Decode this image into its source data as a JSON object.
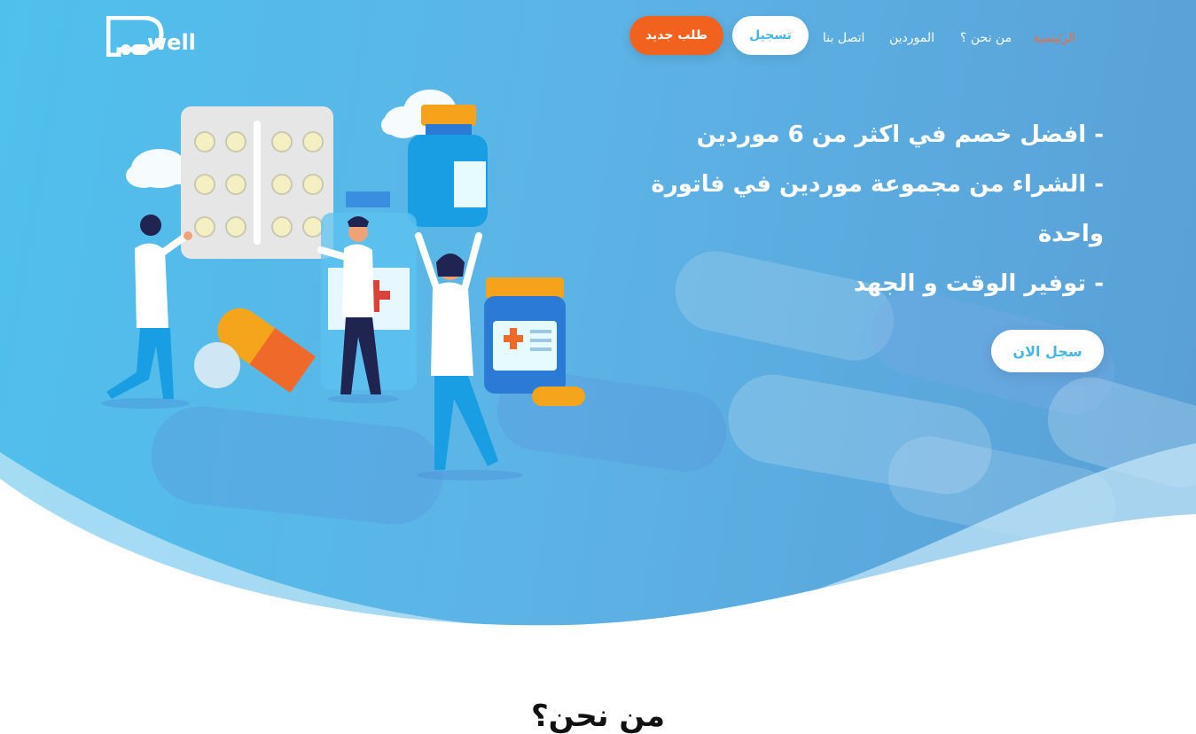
{
  "brand": {
    "logo_text": "well"
  },
  "nav": {
    "items": [
      {
        "label": "الرئيسية",
        "active": true
      },
      {
        "label": "من نحن ؟",
        "active": false
      },
      {
        "label": "الموردين",
        "active": false
      },
      {
        "label": "اتصل بنا",
        "active": false
      }
    ],
    "register_label": "تسجيل",
    "new_order_label": "طلب جديد"
  },
  "hero": {
    "features": [
      "-  افضل خصم في اكثر من 6 موردين",
      "-  الشراء من مجموعة موردين في فاتورة واحدة",
      "-  توفير الوقت و الجهد"
    ],
    "cta_label": "سجل الان"
  },
  "about": {
    "title": "من نحن؟"
  },
  "colors": {
    "accent_orange": "#f2621f",
    "accent_blue": "#46b6e6",
    "active_nav": "#f26b3a"
  }
}
